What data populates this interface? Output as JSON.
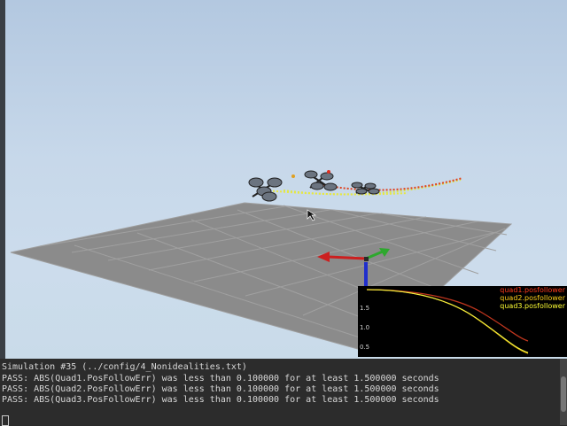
{
  "plot": {
    "ticks": [
      "1.5",
      "1.0",
      "0.5"
    ],
    "legend": [
      {
        "label": "quad1.posfollower",
        "color": "#ff3b1a"
      },
      {
        "label": "quad2.posfollower",
        "color": "#ffd21a"
      },
      {
        "label": "quad3.posfollower",
        "color": "#ffff33"
      }
    ],
    "series_colors": {
      "quad1": "#c8341c",
      "quad2": "#e0b400",
      "quad3": "#ffff40"
    }
  },
  "console": {
    "lines": [
      "Simulation #35 (../config/4_Nonidealities.txt)",
      "PASS: ABS(Quad1.PosFollowErr) was less than 0.100000 for at least 1.500000 seconds",
      "PASS: ABS(Quad2.PosFollowErr) was less than 0.100000 for at least 1.500000 seconds",
      "PASS: ABS(Quad3.PosFollowErr) was less than 0.100000 for at least 1.500000 seconds"
    ]
  },
  "colors": {
    "floor": "#8c8c8c",
    "grid": "#a8a8a8",
    "axis_x": "#cc1f1f",
    "axis_y": "#2ea82e",
    "axis_z": "#1f2ecc",
    "trail_red": "#e0401c",
    "trail_yellow": "#d8e84a"
  }
}
